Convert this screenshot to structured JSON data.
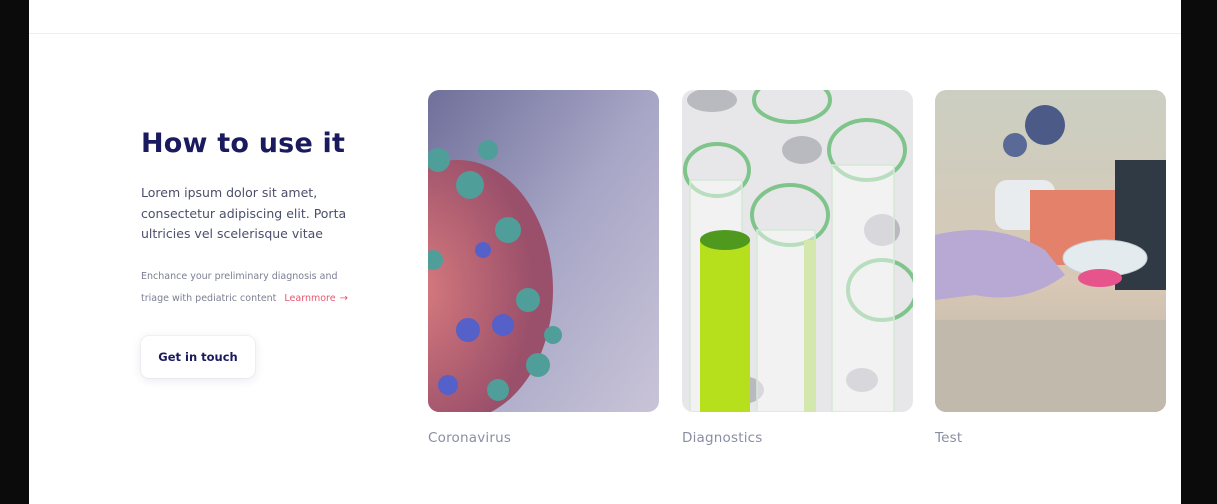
{
  "section": {
    "title": "How to use it",
    "lead_lines": [
      "Lorem ipsum dolor sit amet,",
      "consectetur adipiscing elit. Porta",
      "ultricies vel scelerisque vitae"
    ],
    "note_lines": [
      "Enchance your preliminary diagnosis and",
      "triage with pediatric content"
    ],
    "learn_more": "Learnmore",
    "learn_more_arrow": "→",
    "cta_label": "Get in touch"
  },
  "cards": [
    {
      "caption": "Coronavirus"
    },
    {
      "caption": "Diagnostics"
    },
    {
      "caption": "Test"
    }
  ],
  "colors": {
    "heading": "#1a1a5e",
    "accent_link": "#e8566f",
    "caption": "#8a8ea3"
  }
}
